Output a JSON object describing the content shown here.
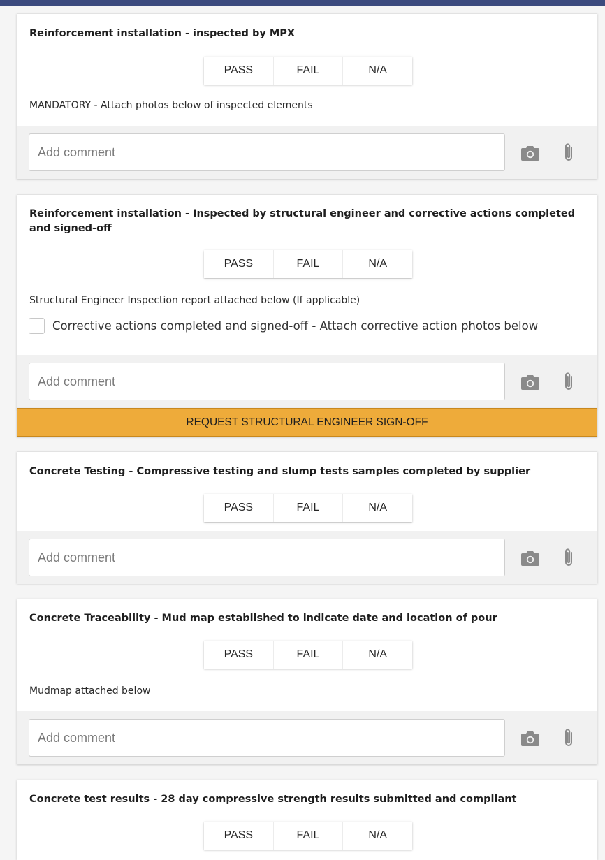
{
  "options": [
    "PASS",
    "FAIL",
    "N/A"
  ],
  "comment_placeholder": "Add comment",
  "cards": [
    {
      "title": "Reinforcement installation - inspected by MPX",
      "note": "MANDATORY - Attach photos below of inspected elements"
    },
    {
      "title": "Reinforcement installation - Inspected by structural engineer and corrective actions completed and signed-off",
      "note": "Structural Engineer Inspection report attached below (If applicable)",
      "checkbox_label": "Corrective actions completed and signed-off - Attach corrective action photos below",
      "checkbox_checked": false,
      "action_button": "REQUEST STRUCTURAL ENGINEER SIGN-OFF"
    },
    {
      "title": "Concrete Testing - Compressive testing and slump tests samples completed by supplier"
    },
    {
      "title": "Concrete Traceability - Mud map established to indicate date and location of pour",
      "note": "Mudmap attached below"
    },
    {
      "title": "Concrete test results - 28 day compressive strength results submitted and compliant"
    }
  ],
  "icons": {
    "camera": "camera-icon",
    "attach": "paperclip-icon"
  },
  "colors": {
    "header_bar": "#3c4a7e",
    "action_button": "#eeab3a"
  }
}
